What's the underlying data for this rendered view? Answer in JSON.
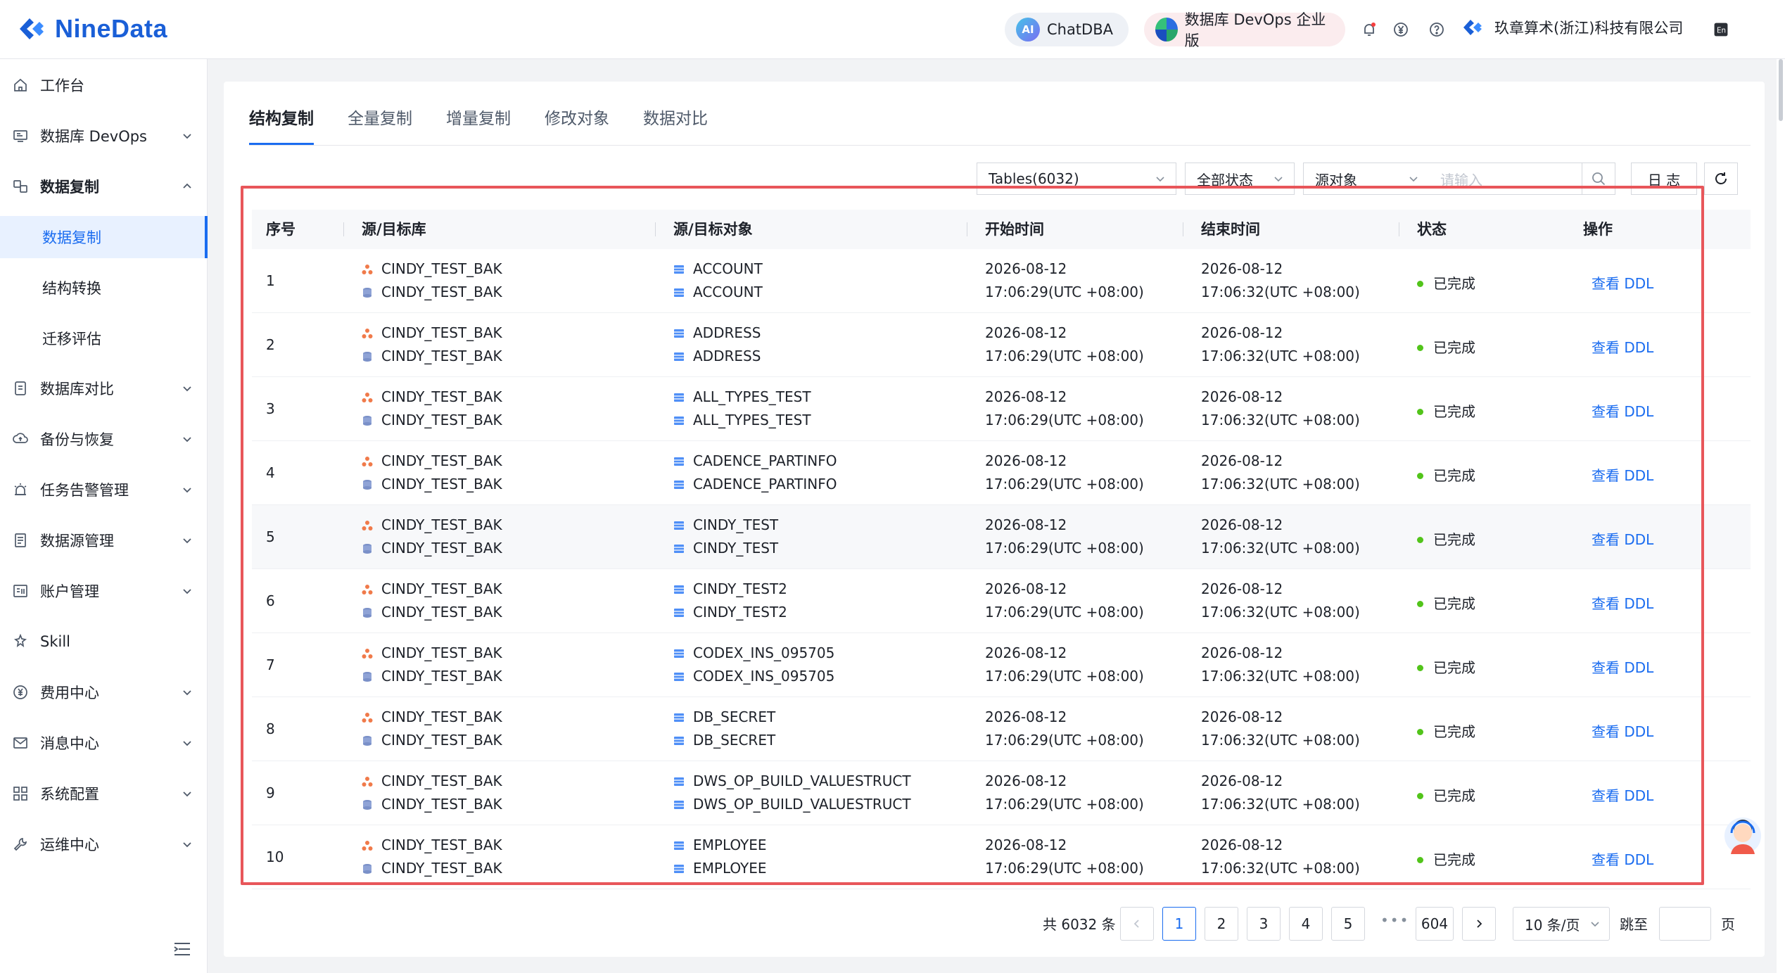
{
  "header": {
    "logo_text": "NineData",
    "chatdba_label": "ChatDBA",
    "chatdba_badge": "AI",
    "devops_label": "数据库 DevOps 企业版",
    "company_name": "玖章算术(浙江)科技有限公司",
    "icons": [
      "bell-icon",
      "yen-icon",
      "help-icon",
      "language-icon"
    ]
  },
  "sidebar": {
    "items": [
      {
        "label": "工作台",
        "icon": "home-icon"
      },
      {
        "label": "数据库 DevOps",
        "icon": "monitor-icon",
        "expandable": true
      },
      {
        "label": "数据复制",
        "icon": "replicate-icon",
        "expanded": true
      },
      {
        "label": "数据复制",
        "sub": true,
        "active": true
      },
      {
        "label": "结构转换",
        "sub": true
      },
      {
        "label": "迁移评估",
        "sub": true
      },
      {
        "label": "数据库对比",
        "icon": "compare-icon",
        "expandable": true
      },
      {
        "label": "备份与恢复",
        "icon": "backup-icon",
        "expandable": true
      },
      {
        "label": "任务告警管理",
        "icon": "alarm-icon",
        "expandable": true
      },
      {
        "label": "数据源管理",
        "icon": "datasource-icon",
        "expandable": true
      },
      {
        "label": "账户管理",
        "icon": "account-icon",
        "expandable": true
      },
      {
        "label": "Skill",
        "icon": "skill-icon"
      },
      {
        "label": "费用中心",
        "icon": "billing-icon",
        "expandable": true
      },
      {
        "label": "消息中心",
        "icon": "mail-icon",
        "expandable": true
      },
      {
        "label": "系统配置",
        "icon": "grid-icon",
        "expandable": true
      },
      {
        "label": "运维中心",
        "icon": "wrench-icon",
        "expandable": true
      }
    ]
  },
  "tabs": [
    "结构复制",
    "全量复制",
    "增量复制",
    "修改对象",
    "数据对比"
  ],
  "filters": {
    "object_type": "Tables(6032)",
    "status": "全部状态",
    "search_field": "源对象",
    "search_placeholder": "请输入",
    "log_button": "日 志"
  },
  "table": {
    "columns": [
      "序号",
      "源/目标库",
      "源/目标对象",
      "开始时间",
      "结束时间",
      "状态",
      "操作"
    ],
    "rows": [
      {
        "idx": "1",
        "src_db": "CINDY_TEST_BAK",
        "dst_db": "CINDY_TEST_BAK",
        "src_obj": "ACCOUNT",
        "dst_obj": "ACCOUNT",
        "start_date": "2026-08-12",
        "start_time": "17:06:29(UTC +08:00)",
        "end_date": "2026-08-12",
        "end_time": "17:06:32(UTC +08:00)",
        "status": "已完成",
        "action": "查看 DDL"
      },
      {
        "idx": "2",
        "src_db": "CINDY_TEST_BAK",
        "dst_db": "CINDY_TEST_BAK",
        "src_obj": "ADDRESS",
        "dst_obj": "ADDRESS",
        "start_date": "2026-08-12",
        "start_time": "17:06:29(UTC +08:00)",
        "end_date": "2026-08-12",
        "end_time": "17:06:32(UTC +08:00)",
        "status": "已完成",
        "action": "查看 DDL"
      },
      {
        "idx": "3",
        "src_db": "CINDY_TEST_BAK",
        "dst_db": "CINDY_TEST_BAK",
        "src_obj": "ALL_TYPES_TEST",
        "dst_obj": "ALL_TYPES_TEST",
        "start_date": "2026-08-12",
        "start_time": "17:06:29(UTC +08:00)",
        "end_date": "2026-08-12",
        "end_time": "17:06:32(UTC +08:00)",
        "status": "已完成",
        "action": "查看 DDL"
      },
      {
        "idx": "4",
        "src_db": "CINDY_TEST_BAK",
        "dst_db": "CINDY_TEST_BAK",
        "src_obj": "CADENCE_PARTINFO",
        "dst_obj": "CADENCE_PARTINFO",
        "start_date": "2026-08-12",
        "start_time": "17:06:29(UTC +08:00)",
        "end_date": "2026-08-12",
        "end_time": "17:06:32(UTC +08:00)",
        "status": "已完成",
        "action": "查看 DDL"
      },
      {
        "idx": "5",
        "src_db": "CINDY_TEST_BAK",
        "dst_db": "CINDY_TEST_BAK",
        "src_obj": "CINDY_TEST",
        "dst_obj": "CINDY_TEST",
        "start_date": "2026-08-12",
        "start_time": "17:06:29(UTC +08:00)",
        "end_date": "2026-08-12",
        "end_time": "17:06:32(UTC +08:00)",
        "status": "已完成",
        "action": "查看 DDL"
      },
      {
        "idx": "6",
        "src_db": "CINDY_TEST_BAK",
        "dst_db": "CINDY_TEST_BAK",
        "src_obj": "CINDY_TEST2",
        "dst_obj": "CINDY_TEST2",
        "start_date": "2026-08-12",
        "start_time": "17:06:29(UTC +08:00)",
        "end_date": "2026-08-12",
        "end_time": "17:06:32(UTC +08:00)",
        "status": "已完成",
        "action": "查看 DDL"
      },
      {
        "idx": "7",
        "src_db": "CINDY_TEST_BAK",
        "dst_db": "CINDY_TEST_BAK",
        "src_obj": "CODEX_INS_095705",
        "dst_obj": "CODEX_INS_095705",
        "start_date": "2026-08-12",
        "start_time": "17:06:29(UTC +08:00)",
        "end_date": "2026-08-12",
        "end_time": "17:06:32(UTC +08:00)",
        "status": "已完成",
        "action": "查看 DDL"
      },
      {
        "idx": "8",
        "src_db": "CINDY_TEST_BAK",
        "dst_db": "CINDY_TEST_BAK",
        "src_obj": "DB_SECRET",
        "dst_obj": "DB_SECRET",
        "start_date": "2026-08-12",
        "start_time": "17:06:29(UTC +08:00)",
        "end_date": "2026-08-12",
        "end_time": "17:06:32(UTC +08:00)",
        "status": "已完成",
        "action": "查看 DDL"
      },
      {
        "idx": "9",
        "src_db": "CINDY_TEST_BAK",
        "dst_db": "CINDY_TEST_BAK",
        "src_obj": "DWS_OP_BUILD_VALUESTRUCT",
        "dst_obj": "DWS_OP_BUILD_VALUESTRUCT",
        "start_date": "2026-08-12",
        "start_time": "17:06:29(UTC +08:00)",
        "end_date": "2026-08-12",
        "end_time": "17:06:32(UTC +08:00)",
        "status": "已完成",
        "action": "查看 DDL"
      },
      {
        "idx": "10",
        "src_db": "CINDY_TEST_BAK",
        "dst_db": "CINDY_TEST_BAK",
        "src_obj": "EMPLOYEE",
        "dst_obj": "EMPLOYEE",
        "start_date": "2026-08-12",
        "start_time": "17:06:29(UTC +08:00)",
        "end_date": "2026-08-12",
        "end_time": "17:06:32(UTC +08:00)",
        "status": "已完成",
        "action": "查看 DDL"
      }
    ]
  },
  "pagination": {
    "total": "共 6032 条",
    "pages": [
      "1",
      "2",
      "3",
      "4",
      "5"
    ],
    "ellipsis": "•••",
    "last_page": "604",
    "current": "1",
    "page_size": "10 条/页",
    "jump_label": "跳至",
    "page_suffix": "页"
  },
  "colors": {
    "accent": "#1a6cf0",
    "highlight_border": "#e8565a",
    "status_done": "#52c41a"
  }
}
